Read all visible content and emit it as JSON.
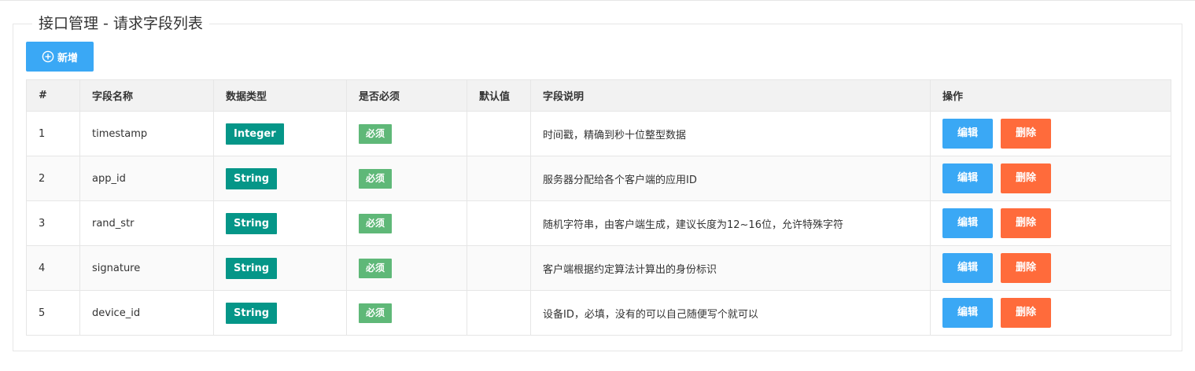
{
  "page": {
    "title": "接口管理 - 请求字段列表",
    "add_button": "新增"
  },
  "colors": {
    "primary": "#3aa8f5",
    "danger": "#ff6b3b",
    "type_badge": "#059688",
    "required_badge": "#5fb878"
  },
  "table": {
    "headers": [
      "#",
      "字段名称",
      "数据类型",
      "是否必须",
      "默认值",
      "字段说明",
      "操作"
    ],
    "rows": [
      {
        "index": "1",
        "name": "timestamp",
        "type": "Integer",
        "required": "必须",
        "default": "",
        "desc": "时间戳，精确到秒十位整型数据"
      },
      {
        "index": "2",
        "name": "app_id",
        "type": "String",
        "required": "必须",
        "default": "",
        "desc": "服务器分配给各个客户端的应用ID"
      },
      {
        "index": "3",
        "name": "rand_str",
        "type": "String",
        "required": "必须",
        "default": "",
        "desc": "随机字符串，由客户端生成，建议长度为12~16位，允许特殊字符"
      },
      {
        "index": "4",
        "name": "signature",
        "type": "String",
        "required": "必须",
        "default": "",
        "desc": "客户端根据约定算法计算出的身份标识"
      },
      {
        "index": "5",
        "name": "device_id",
        "type": "String",
        "required": "必须",
        "default": "",
        "desc": "设备ID，必填，没有的可以自己随便写个就可以"
      }
    ],
    "edit_label": "编辑",
    "delete_label": "删除"
  }
}
